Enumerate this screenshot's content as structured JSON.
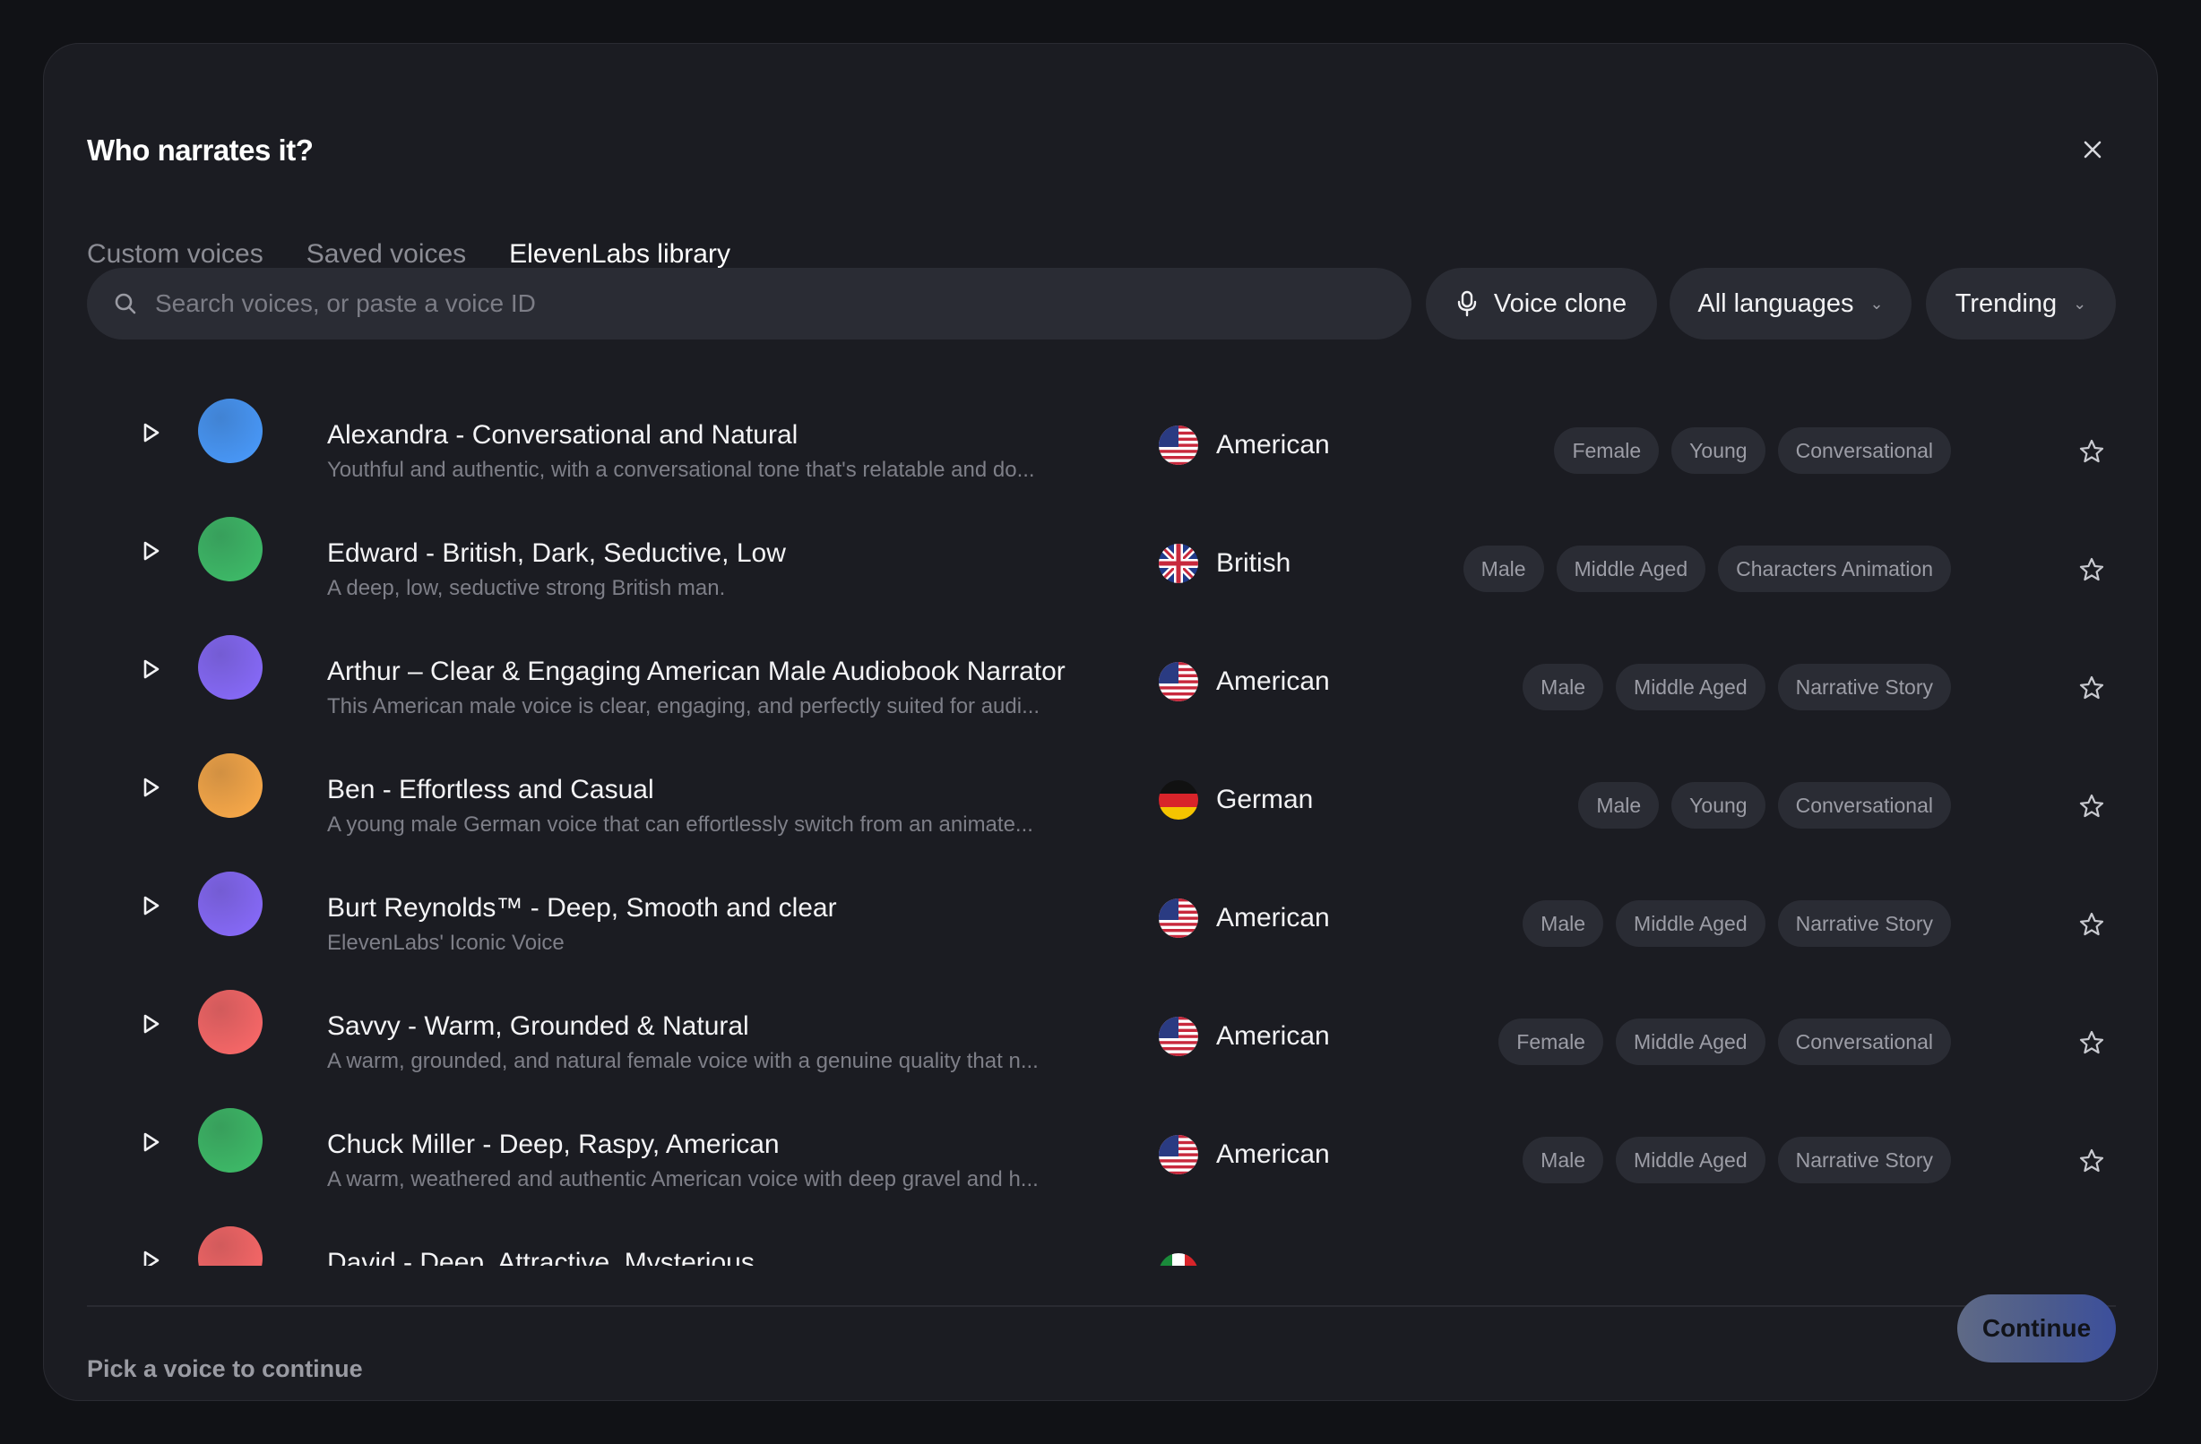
{
  "modal": {
    "title": "Who narrates it?",
    "close_icon": "close-icon"
  },
  "tabs": [
    {
      "label": "Custom voices",
      "active": false
    },
    {
      "label": "Saved voices",
      "active": false
    },
    {
      "label": "ElevenLabs library",
      "active": true
    }
  ],
  "search": {
    "placeholder": "Search voices, or paste a voice ID",
    "icon": "search-icon"
  },
  "filters": {
    "voice_clone_label": "Voice clone",
    "languages_label": "All languages",
    "sort_label": "Trending"
  },
  "voices": [
    {
      "name": "Alexandra - Conversational and Natural",
      "desc": "Youthful and authentic, with a conversational tone that's relatable and do...",
      "accent": "American",
      "flag": "us",
      "tags": [
        "Female",
        "Young",
        "Conversational"
      ],
      "color": "#4a9cff"
    },
    {
      "name": "Edward - British, Dark, Seductive, Low",
      "desc": "A deep, low, seductive strong British man.",
      "accent": "British",
      "flag": "uk",
      "tags": [
        "Male",
        "Middle Aged",
        "Characters Animation"
      ],
      "color": "#3fbf6a"
    },
    {
      "name": "Arthur – Clear & Engaging American Male Audiobook Narrator",
      "desc": "This American male voice is clear, engaging, and perfectly suited for audi...",
      "accent": "American",
      "flag": "us",
      "tags": [
        "Male",
        "Middle Aged",
        "Narrative Story"
      ],
      "color": "#8a6cff"
    },
    {
      "name": "Ben - Effortless and Casual",
      "desc": "A young male German voice that can effortlessly switch from an animate...",
      "accent": "German",
      "flag": "de",
      "tags": [
        "Male",
        "Young",
        "Conversational"
      ],
      "color": "#ffad4a"
    },
    {
      "name": "Burt Reynolds™ - Deep, Smooth and clear",
      "desc": "ElevenLabs' Iconic Voice",
      "accent": "American",
      "flag": "us",
      "tags": [
        "Male",
        "Middle Aged",
        "Narrative Story"
      ],
      "color": "#8a6cff"
    },
    {
      "name": "Savvy - Warm, Grounded & Natural",
      "desc": "A warm, grounded, and natural female voice with a genuine quality that n...",
      "accent": "American",
      "flag": "us",
      "tags": [
        "Female",
        "Middle Aged",
        "Conversational"
      ],
      "color": "#ff6a6a"
    },
    {
      "name": "Chuck Miller - Deep, Raspy, American",
      "desc": "A warm, weathered and authentic American voice with deep gravel and h...",
      "accent": "American",
      "flag": "us",
      "tags": [
        "Male",
        "Middle Aged",
        "Narrative Story"
      ],
      "color": "#3fbf6a"
    },
    {
      "name": "David - Deep, Attractive, Mysterious",
      "desc": "",
      "accent": "",
      "flag": "it",
      "tags": [],
      "color": "#ff6a6a"
    }
  ],
  "footer": {
    "hint": "Pick a voice to continue",
    "continue_label": "Continue"
  }
}
